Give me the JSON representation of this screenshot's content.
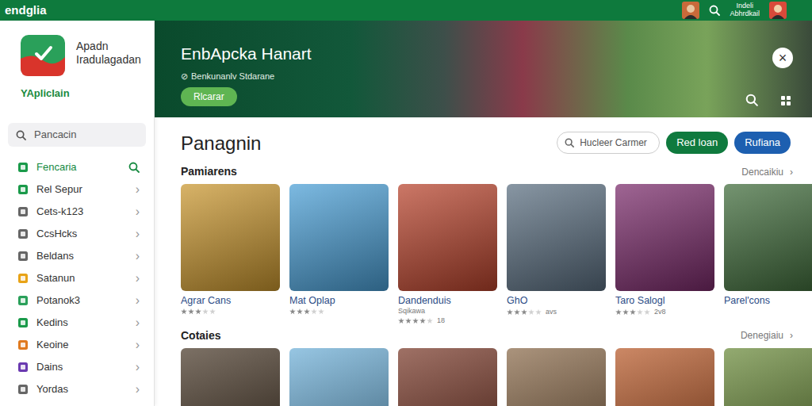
{
  "topbar": {
    "brand": "endglia",
    "user": {
      "line1": "Indeli",
      "line2": "Abhrdkail"
    }
  },
  "sidebar": {
    "app": {
      "name_line1": "Apadn",
      "name_line2": "Iradulagadan",
      "category": "YAplicIain"
    },
    "search": {
      "placeholder": "Pancacin"
    },
    "chevron": "›",
    "items": [
      {
        "label": "Fencaria",
        "selected": true,
        "color": "#1a9a4a"
      },
      {
        "label": "Rel Sepur",
        "selected": false,
        "color": "#1a9a4a"
      },
      {
        "label": "Cets-k123",
        "selected": false,
        "color": "#666666"
      },
      {
        "label": "CcsHcks",
        "selected": false,
        "color": "#666666"
      },
      {
        "label": "Beldans",
        "selected": false,
        "color": "#666666"
      },
      {
        "label": "Satanun",
        "selected": false,
        "color": "#e8a317"
      },
      {
        "label": "Potanok3",
        "selected": false,
        "color": "#2aa05a"
      },
      {
        "label": "Kedins",
        "selected": false,
        "color": "#1a9a4a"
      },
      {
        "label": "Keoine",
        "selected": false,
        "color": "#e07a1f"
      },
      {
        "label": "Dains",
        "selected": false,
        "color": "#6a3ab0"
      },
      {
        "label": "Yordas",
        "selected": false,
        "color": "#666666"
      }
    ]
  },
  "banner": {
    "title": "EnbApcka Hanart",
    "subtitle_icon": "⊘",
    "subtitle": "Benkunanlv Stdarane",
    "button": "Rlcarar",
    "close": "×"
  },
  "page": {
    "title": "Panagnin",
    "search": {
      "placeholder": "Hucleer Carmer"
    },
    "buttons": [
      {
        "label": "Red loan",
        "kind": "green"
      },
      {
        "label": "Rufiana",
        "kind": "blue"
      }
    ]
  },
  "sections": [
    {
      "title": "Pamiarens",
      "more": "Dencaikiu",
      "more_icon": "›",
      "games": [
        {
          "name": "Agrar Cans",
          "stars": 3,
          "color": "#c9962e"
        },
        {
          "name": "Mat Oplap",
          "stars": 3,
          "color": "#4a9fd6"
        },
        {
          "name": "Dandenduis",
          "subtitle": "Sqikawa",
          "stars": 4,
          "reading": "18",
          "color": "#b8432c"
        },
        {
          "name": "GhO",
          "stars": 3,
          "reading": "avs",
          "color": "#5a6e80"
        },
        {
          "name": "Taro Salogl",
          "stars": 3,
          "reading": "2v8",
          "color": "#7a2a6a"
        },
        {
          "name": "Parel'cons",
          "color": "#3f6b3a"
        }
      ]
    },
    {
      "title": "Cotaies",
      "more": "Denegiaiu",
      "more_icon": "›",
      "games": [
        {
          "color": "#4a3a2a"
        },
        {
          "color": "#6fb0d8"
        },
        {
          "color": "#7a3a2a"
        },
        {
          "color": "#8a6a4a"
        },
        {
          "color": "#b85a2a"
        },
        {
          "color": "#6a8a3a"
        }
      ]
    }
  ]
}
